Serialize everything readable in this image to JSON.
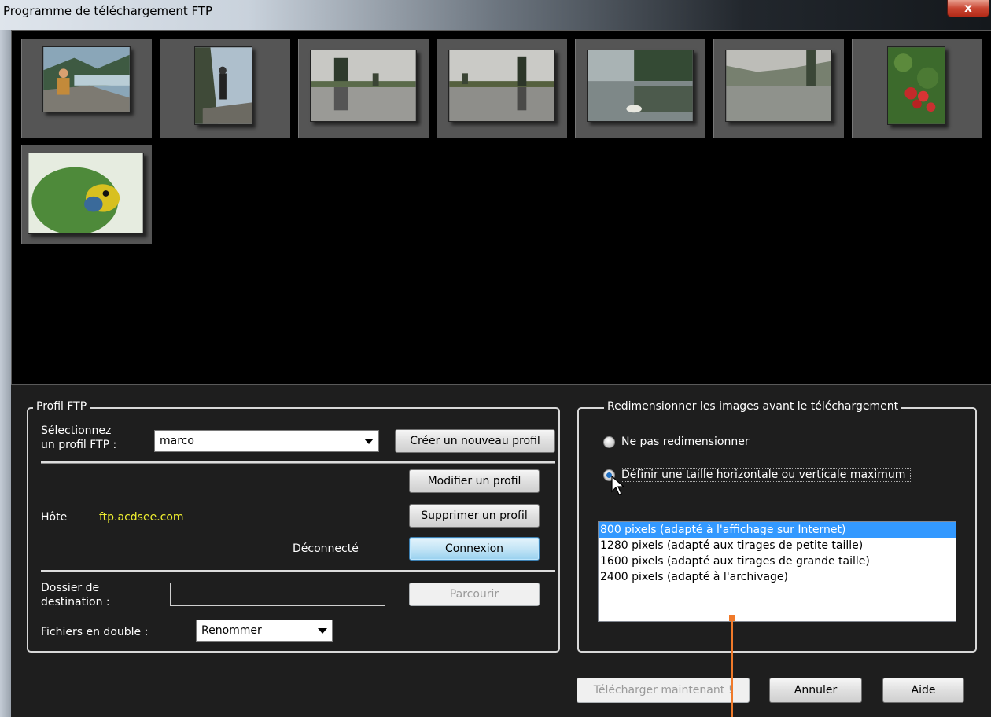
{
  "window": {
    "title": "Programme de téléchargement FTP",
    "close_label": "x"
  },
  "thumbnails": [
    {
      "name": "thumb-hiker-lake"
    },
    {
      "name": "thumb-hiker-standing"
    },
    {
      "name": "thumb-pond-reflection-1"
    },
    {
      "name": "thumb-pond-reflection-2"
    },
    {
      "name": "thumb-misty-lake"
    },
    {
      "name": "thumb-foggy-pond"
    },
    {
      "name": "thumb-red-flowers"
    },
    {
      "name": "thumb-parrot"
    }
  ],
  "ftp_profile": {
    "legend": "Profil FTP",
    "select_label_line1": "Sélectionnez",
    "select_label_line2": "un profil FTP :",
    "selected_profile": "marco",
    "new_profile_button": "Créer un nouveau profil",
    "edit_profile_button": "Modifier un profil",
    "delete_profile_button": "Supprimer un profil",
    "host_label": "Hôte",
    "host_value": "ftp.acdsee.com",
    "status": "Déconnecté",
    "connect_button": "Connexion",
    "dest_label_line1": "Dossier de",
    "dest_label_line2": "destination :",
    "dest_value": "",
    "browse_button": "Parcourir",
    "duplicates_label": "Fichiers en double :",
    "duplicates_value": "Renommer"
  },
  "resize": {
    "legend": "Redimensionner les images avant le téléchargement",
    "option_none": "Ne pas redimensionner",
    "option_max": "Définir une taille horizontale ou verticale maximum",
    "sizes": [
      "800 pixels (adapté à l'affichage sur Internet)",
      "1280 pixels (adapté aux tirages de petite taille)",
      "1600 pixels (adapté aux tirages de grande taille)",
      "2400 pixels (adapté à l'archivage)"
    ],
    "selected_index": 0
  },
  "footer": {
    "upload_button": "Télécharger maintenant !",
    "cancel_button": "Annuler",
    "help_button": "Aide"
  },
  "colors": {
    "host_value": "#f0f030",
    "list_selection": "#3399ff",
    "callout": "#f07a2a"
  }
}
